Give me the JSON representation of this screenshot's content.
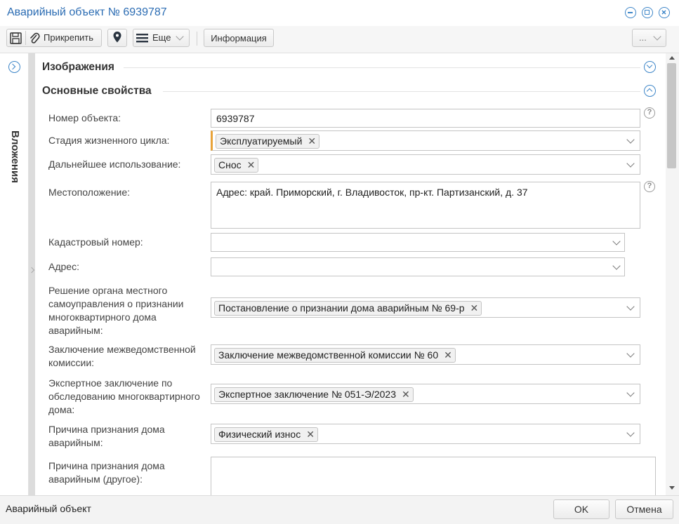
{
  "window": {
    "title": "Аварийный объект № 6939787"
  },
  "toolbar": {
    "attach_label": "Прикрепить",
    "more_label": "Еще",
    "info_label": "Информация",
    "overflow_label": "..."
  },
  "sidebar": {
    "label": "Вложения"
  },
  "sections": {
    "images": "Изображения",
    "main": "Основные свойства"
  },
  "fields": {
    "object_number": {
      "label": "Номер объекта:",
      "value": "6939787"
    },
    "lifecycle_stage": {
      "label": "Стадия жизненного цикла:",
      "tag": "Эксплуатируемый"
    },
    "further_use": {
      "label": "Дальнейшее использование:",
      "tag": "Снос"
    },
    "location": {
      "label": "Местоположение:",
      "value": "Адрес: край. Приморский, г. Владивосток, пр-кт. Партизанский, д. 37"
    },
    "cadastral": {
      "label": "Кадастровый номер:",
      "value": ""
    },
    "address": {
      "label": "Адрес:",
      "value": ""
    },
    "decision": {
      "label_lines": [
        "Решение органа местного",
        "самоуправления о признании",
        "многоквартирного дома",
        "аварийным:"
      ],
      "tag": "Постановление о признании дома аварийным № 69-р"
    },
    "commission": {
      "label_lines": [
        "Заключение межведомственной",
        "комиссии:"
      ],
      "tag": "Заключение межведомственной комиссии № 60"
    },
    "expert": {
      "label_lines": [
        "Экспертное заключение по",
        "обследованию многоквартирного",
        "дома:"
      ],
      "tag": "Экспертное заключение № 051-Э/2023"
    },
    "reason": {
      "label_lines": [
        "Причина признания дома",
        "аварийным:"
      ],
      "tag": "Физический износ"
    },
    "reason_other": {
      "label_lines": [
        "Причина признания дома",
        "аварийным (другое):"
      ],
      "value": ""
    }
  },
  "footer": {
    "entity": "Аварийный объект",
    "ok": "OK",
    "cancel": "Отмена"
  },
  "colors": {
    "accent": "#2b6cb3",
    "required_marker": "#e8a33a"
  }
}
